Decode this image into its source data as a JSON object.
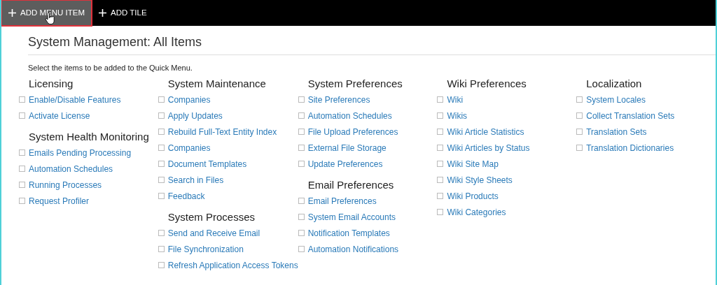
{
  "toolbar": {
    "buttons": [
      {
        "label": "ADD MENU ITEM",
        "selected": true,
        "annotated": true
      },
      {
        "label": "ADD TILE",
        "selected": false,
        "annotated": false
      }
    ]
  },
  "page": {
    "title": "System Management: All Items",
    "instructions": "Select the items to be added to the Quick Menu."
  },
  "columns": [
    {
      "groups": [
        {
          "heading": "Licensing",
          "items": [
            {
              "label": "Enable/Disable Features",
              "checked": false
            },
            {
              "label": "Activate License",
              "checked": false
            }
          ]
        },
        {
          "heading": "System Health Monitoring",
          "items": [
            {
              "label": "Emails Pending Processing",
              "checked": false
            },
            {
              "label": "Automation Schedules",
              "checked": false
            },
            {
              "label": "Running Processes",
              "checked": false
            },
            {
              "label": "Request Profiler",
              "checked": false
            }
          ]
        }
      ]
    },
    {
      "groups": [
        {
          "heading": "System Maintenance",
          "items": [
            {
              "label": "Companies",
              "checked": false
            },
            {
              "label": "Apply Updates",
              "checked": false
            },
            {
              "label": "Rebuild Full-Text Entity Index",
              "checked": false
            },
            {
              "label": "Companies",
              "checked": false
            },
            {
              "label": "Document Templates",
              "checked": false
            },
            {
              "label": "Search in Files",
              "checked": false
            },
            {
              "label": "Feedback",
              "checked": false
            }
          ]
        },
        {
          "heading": "System Processes",
          "items": [
            {
              "label": "Send and Receive Email",
              "checked": false
            },
            {
              "label": "File Synchronization",
              "checked": false
            },
            {
              "label": "Refresh Application Access Tokens",
              "checked": false
            }
          ]
        }
      ]
    },
    {
      "groups": [
        {
          "heading": "System Preferences",
          "items": [
            {
              "label": "Site Preferences",
              "checked": false
            },
            {
              "label": "Automation Schedules",
              "checked": false
            },
            {
              "label": "File Upload Preferences",
              "checked": false
            },
            {
              "label": "External File Storage",
              "checked": false
            },
            {
              "label": "Update Preferences",
              "checked": false
            }
          ]
        },
        {
          "heading": "Email Preferences",
          "items": [
            {
              "label": "Email Preferences",
              "checked": false
            },
            {
              "label": "System Email Accounts",
              "checked": false
            },
            {
              "label": "Notification Templates",
              "checked": false
            },
            {
              "label": "Automation Notifications",
              "checked": false
            }
          ]
        }
      ]
    },
    {
      "groups": [
        {
          "heading": "Wiki Preferences",
          "items": [
            {
              "label": "Wiki",
              "checked": false
            },
            {
              "label": "Wikis",
              "checked": false
            },
            {
              "label": "Wiki Article Statistics",
              "checked": false
            },
            {
              "label": "Wiki Articles by Status",
              "checked": false
            },
            {
              "label": "Wiki Site Map",
              "checked": false
            },
            {
              "label": "Wiki Style Sheets",
              "checked": false
            },
            {
              "label": "Wiki Products",
              "checked": false
            },
            {
              "label": "Wiki Categories",
              "checked": false
            }
          ]
        }
      ]
    },
    {
      "groups": [
        {
          "heading": "Localization",
          "items": [
            {
              "label": "System Locales",
              "checked": false
            },
            {
              "label": "Collect Translation Sets",
              "checked": false
            },
            {
              "label": "Translation Sets",
              "checked": false
            },
            {
              "label": "Translation Dictionaries",
              "checked": false
            }
          ]
        }
      ]
    }
  ]
}
